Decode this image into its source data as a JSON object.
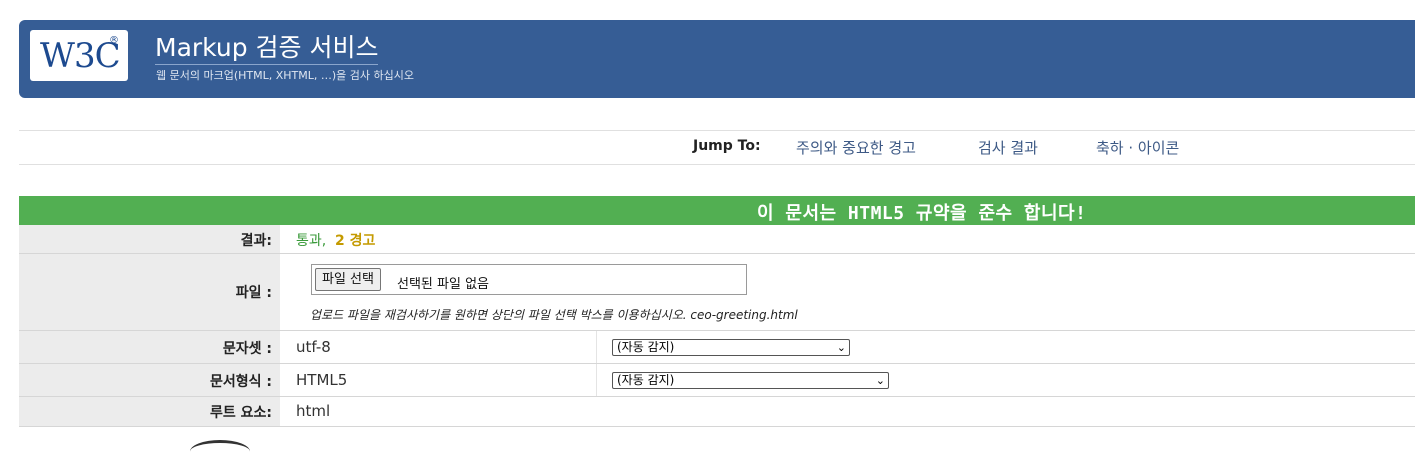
{
  "banner": {
    "logo_text": "W3C",
    "logo_reg": "®",
    "title": "Markup 검증 서비스",
    "subtitle": "웹 문서의 마크업(HTML, XHTML, …)을 검사 하십시오",
    "bg_color": "#365d95"
  },
  "jump": {
    "label": "Jump To:",
    "links": [
      "주의와 중요한 경고",
      "검사 결과",
      "축하 · 아이콘"
    ]
  },
  "result": {
    "header_text": "이 문서는 HTML5 규약을 준수 합니다!",
    "header_color": "#52af52"
  },
  "table": {
    "result_label": "결과:",
    "result_pass": "통과,",
    "result_warn": "2 경고",
    "file_label": "파일 :",
    "file_button": "파일 선택",
    "file_status": "선택된 파일 없음",
    "file_note": "업로드 파일을 재검사하기를 원하면 상단의 파일 선택 박스를 이용하십시오. ceo-greeting.html",
    "charset_label": "문자셋 :",
    "charset_value": "utf-8",
    "charset_select": "(자동 감지)",
    "doctype_label": "문서형식 :",
    "doctype_value": "HTML5",
    "doctype_select": "(자동 감지)",
    "root_label": "루트 요소:",
    "root_value": "html"
  }
}
